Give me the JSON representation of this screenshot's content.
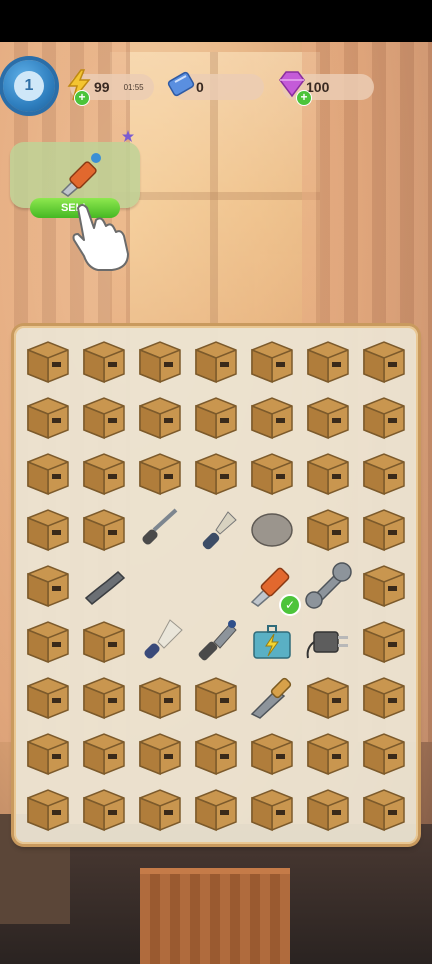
{
  "hud": {
    "level": "1",
    "energy": {
      "value": "99",
      "timer": "01:55"
    },
    "tickets": {
      "value": "0"
    },
    "gems": {
      "value": "100"
    }
  },
  "order": {
    "item_icon": "utility-knife-icon",
    "claim_label": "SELL"
  },
  "board": {
    "columns": 7,
    "rows": 9,
    "cells": [
      [
        "box",
        "box",
        "box",
        "box",
        "box",
        "box",
        "box"
      ],
      [
        "box",
        "box",
        "box",
        "box",
        "box",
        "box",
        "box"
      ],
      [
        "box",
        "box",
        "box",
        "box",
        "box",
        "box",
        "box"
      ],
      [
        "box",
        "box",
        "screwdriver",
        "paintbrush",
        "stone",
        "box",
        "box"
      ],
      [
        "box",
        "bent-wrench",
        "empty",
        "empty",
        "utility-knife",
        "wrench",
        "box"
      ],
      [
        "box",
        "box",
        "feather-duster",
        "chisel",
        "toolbox",
        "power-plug",
        "box"
      ],
      [
        "box",
        "box",
        "box",
        "box",
        "knife-blade",
        "box",
        "box"
      ],
      [
        "box",
        "box",
        "box",
        "box",
        "box",
        "box",
        "box"
      ],
      [
        "box",
        "box",
        "box",
        "box",
        "box",
        "box",
        "box"
      ]
    ]
  },
  "colors": {
    "box": "#c9964f",
    "board_border": "#c99a5e",
    "accent_green": "#4cc43a",
    "level_blue": "#2f7fbf"
  }
}
